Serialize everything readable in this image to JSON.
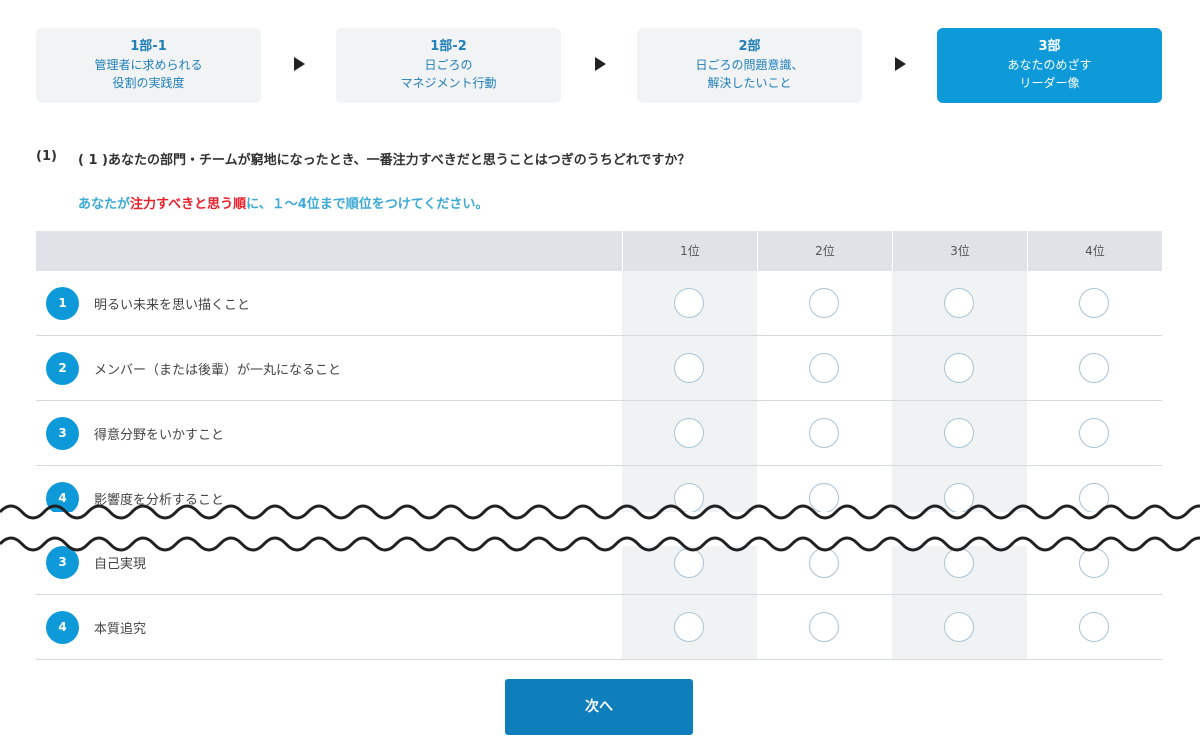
{
  "steps": [
    {
      "title": "1部-1",
      "line1": "管理者に求められる",
      "line2": "役割の実践度"
    },
    {
      "title": "1部-2",
      "line1": "日ごろの",
      "line2": "マネジメント行動"
    },
    {
      "title": "2部",
      "line1": "日ごろの問題意識、",
      "line2": "解決したいこと"
    },
    {
      "title": "3部",
      "line1": "あなたのめざす",
      "line2": "リーダー像"
    }
  ],
  "question": {
    "number": "(1)",
    "text": "( 1 )あなたの部門・チームが窮地になったとき、一番注力すべきだと思うことはつぎのうちどれですか？"
  },
  "instruction": {
    "before": "あなたが",
    "emphasis": "注力すべきと思う順",
    "after": "に、１～4位まで順位をつけてください。"
  },
  "columns": [
    "1位",
    "2位",
    "3位",
    "4位"
  ],
  "rows": [
    {
      "num": "1",
      "label": "明るい未来を思い描くこと"
    },
    {
      "num": "2",
      "label": "メンバー（または後輩）が一丸になること"
    },
    {
      "num": "3",
      "label": "得意分野をいかすこと"
    },
    {
      "num": "4",
      "label": "影響度を分析すること"
    },
    {
      "num": "3",
      "label": "自己実現"
    },
    {
      "num": "4",
      "label": "本質追究"
    }
  ],
  "next_label": "次へ",
  "colors": {
    "accent": "#0e9ad9",
    "button": "#0f7fbb",
    "emphasis": "#e8202a",
    "instruction": "#3daad6"
  }
}
